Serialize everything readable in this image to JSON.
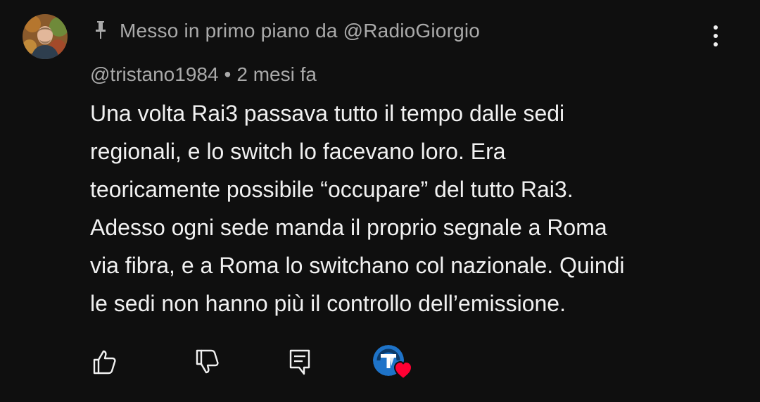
{
  "pinned": {
    "icon": "pin-icon",
    "text": "Messo in primo piano da @RadioGiorgio"
  },
  "comment": {
    "author": "@tristano1984",
    "separator": "•",
    "time": "2 mesi fa",
    "lines": [
      "Una volta Rai3 passava tutto il tempo dalle sedi",
      "regionali, e lo switch lo facevano loro. Era",
      "teoricamente possibile “occupare” del tutto Rai3.",
      "Adesso ogni sede manda il proprio segnale a Roma",
      "via fibra, e a Roma lo switchano col nazionale. Quindi",
      "le sedi non hanno più il controllo dell’emissione."
    ]
  },
  "actions": {
    "like_icon": "thumbs-up-icon",
    "dislike_icon": "thumbs-down-icon",
    "reply_icon": "reply-comment-icon",
    "creator_heart_icon": "creator-heart-icon"
  },
  "colors": {
    "background": "#0f0f0f",
    "text_primary": "#f1f1f1",
    "text_secondary": "#aaaaaa",
    "heart_red": "#ff0033",
    "creator_avatar_blue": "#1e73c8"
  }
}
